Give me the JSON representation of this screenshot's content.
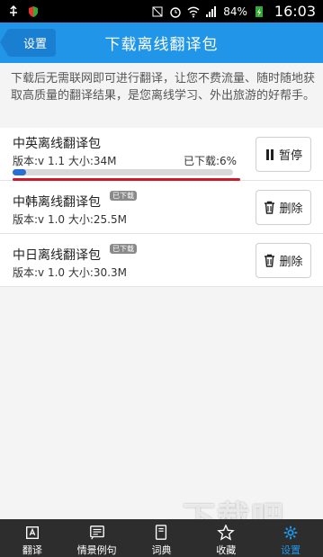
{
  "status": {
    "battery_pct": "84%",
    "time": "16:03"
  },
  "header": {
    "back_label": "设置",
    "title": "下载离线翻译包"
  },
  "intro": "下载后无需联网即可进行翻译，让您不费流量、随时随地获取高质量的翻译结果，是您离线学习、外出旅游的好帮手。",
  "packages": [
    {
      "name": "中英离线翻译包",
      "meta": "版本:v 1.1 大小:34M",
      "progress_label": "已下载:6%",
      "progress": 0.06,
      "button": "暂停",
      "button_icon": "pause-icon"
    },
    {
      "name": "中韩离线翻译包",
      "badge": "已下载",
      "meta": "版本:v 1.0 大小:25.5M",
      "button": "删除",
      "button_icon": "trash-icon"
    },
    {
      "name": "中日离线翻译包",
      "badge": "已下载",
      "meta": "版本:v 1.0 大小:30.3M",
      "button": "删除",
      "button_icon": "trash-icon"
    }
  ],
  "nav": [
    {
      "label": "翻译",
      "icon": "translate-icon"
    },
    {
      "label": "情景例句",
      "icon": "sentence-icon"
    },
    {
      "label": "词典",
      "icon": "dictionary-icon"
    },
    {
      "label": "收藏",
      "icon": "star-icon"
    },
    {
      "label": "设置",
      "icon": "gear-icon",
      "active": true
    }
  ],
  "watermark": "下载吧",
  "colors": {
    "header": "#2196e8",
    "progress": "#2a6fd6",
    "underline": "#cc1a2a",
    "nav_active": "#2196e8"
  }
}
